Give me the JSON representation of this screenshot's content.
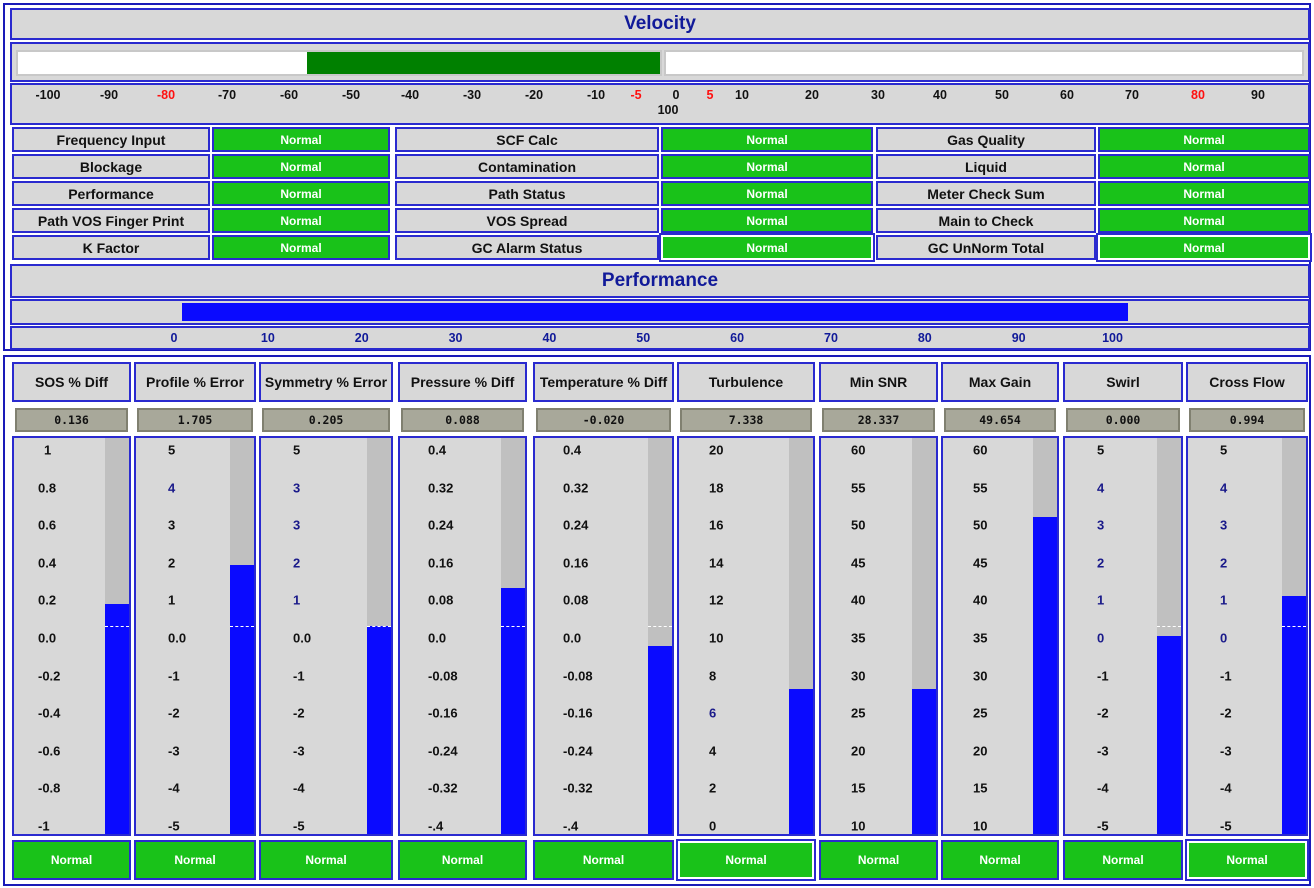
{
  "velocity": {
    "title": "Velocity",
    "value_range": [
      -55,
      0
    ],
    "scale": [
      {
        "label": "-100",
        "color": "black"
      },
      {
        "label": "-90",
        "color": "black"
      },
      {
        "label": "-80",
        "color": "red"
      },
      {
        "label": "-70",
        "color": "black"
      },
      {
        "label": "-60",
        "color": "black"
      },
      {
        "label": "-50",
        "color": "black"
      },
      {
        "label": "-40",
        "color": "black"
      },
      {
        "label": "-30",
        "color": "black"
      },
      {
        "label": "-20",
        "color": "black"
      },
      {
        "label": "-10",
        "color": "black"
      },
      {
        "label": "-5",
        "color": "red"
      },
      {
        "label": "0",
        "color": "black"
      },
      {
        "label": "5",
        "color": "red"
      },
      {
        "label": "10",
        "color": "black"
      },
      {
        "label": "20",
        "color": "black"
      },
      {
        "label": "30",
        "color": "black"
      },
      {
        "label": "40",
        "color": "black"
      },
      {
        "label": "50",
        "color": "black"
      },
      {
        "label": "60",
        "color": "black"
      },
      {
        "label": "70",
        "color": "black"
      },
      {
        "label": "80",
        "color": "red"
      },
      {
        "label": "90",
        "color": "black"
      },
      {
        "label": "100",
        "color": "black"
      }
    ]
  },
  "alarms": [
    {
      "label": "Frequency Input",
      "status": "Normal"
    },
    {
      "label": "SCF Calc",
      "status": "Normal"
    },
    {
      "label": "Gas Quality",
      "status": "Normal"
    },
    {
      "label": "Blockage",
      "status": "Normal"
    },
    {
      "label": "Contamination",
      "status": "Normal"
    },
    {
      "label": "Liquid",
      "status": "Normal"
    },
    {
      "label": "Performance",
      "status": "Normal"
    },
    {
      "label": "Path Status",
      "status": "Normal"
    },
    {
      "label": "Meter Check Sum",
      "status": "Normal"
    },
    {
      "label": "Path VOS Finger Print",
      "status": "Normal"
    },
    {
      "label": "VOS Spread",
      "status": "Normal"
    },
    {
      "label": "Main to Check",
      "status": "Normal"
    },
    {
      "label": "K Factor",
      "status": "Normal"
    },
    {
      "label": "GC Alarm Status",
      "status": "Normal"
    },
    {
      "label": "GC UnNorm Total",
      "status": "Normal"
    }
  ],
  "performance": {
    "title": "Performance",
    "value_percent": 100,
    "scale": [
      {
        "label": "0",
        "color": "blue"
      },
      {
        "label": "10",
        "color": "blue"
      },
      {
        "label": "20",
        "color": "blue"
      },
      {
        "label": "30",
        "color": "blue"
      },
      {
        "label": "40",
        "color": "blue"
      },
      {
        "label": "50",
        "color": "blue"
      },
      {
        "label": "60",
        "color": "blue"
      },
      {
        "label": "70",
        "color": "blue"
      },
      {
        "label": "80",
        "color": "blue"
      },
      {
        "label": "90",
        "color": "red"
      },
      {
        "label": "100",
        "color": "blue"
      }
    ]
  },
  "diagnostics": [
    {
      "title": "SOS % Diff",
      "value": "0.136",
      "status": "Normal",
      "fill_fraction": 0.58,
      "zero_fraction": 0.5,
      "scale": [
        {
          "t": "1",
          "c": 0
        },
        {
          "t": "0.8",
          "c": 0
        },
        {
          "t": "0.6",
          "c": 0
        },
        {
          "t": "0.4",
          "c": 0
        },
        {
          "t": "0.2",
          "c": 0
        },
        {
          "t": "0.0",
          "c": 0
        },
        {
          "t": "-0.2",
          "c": 0
        },
        {
          "t": "-0.4",
          "c": 0
        },
        {
          "t": "-0.6",
          "c": 0
        },
        {
          "t": "-0.8",
          "c": 0
        },
        {
          "t": "-1",
          "c": 0
        }
      ]
    },
    {
      "title": "Profile % Error",
      "value": "1.705",
      "status": "Normal",
      "fill_fraction": 0.68,
      "zero_fraction": 0.5,
      "scale": [
        {
          "t": "5",
          "c": 0
        },
        {
          "t": "4",
          "c": 1
        },
        {
          "t": "3",
          "c": 0
        },
        {
          "t": "2",
          "c": 0
        },
        {
          "t": "1",
          "c": 0
        },
        {
          "t": "0.0",
          "c": 0
        },
        {
          "t": "-1",
          "c": 0
        },
        {
          "t": "-2",
          "c": 0
        },
        {
          "t": "-3",
          "c": 0
        },
        {
          "t": "-4",
          "c": 0
        },
        {
          "t": "-5",
          "c": 0
        }
      ]
    },
    {
      "title": "Symmetry % Error",
      "value": "0.205",
      "status": "Normal",
      "fill_fraction": 0.525,
      "zero_fraction": 0.5,
      "scale": [
        {
          "t": "5",
          "c": 0
        },
        {
          "t": "3",
          "c": 1
        },
        {
          "t": "3",
          "c": 1
        },
        {
          "t": "2",
          "c": 1
        },
        {
          "t": "1",
          "c": 1
        },
        {
          "t": "0.0",
          "c": 0
        },
        {
          "t": "-1",
          "c": 0
        },
        {
          "t": "-2",
          "c": 0
        },
        {
          "t": "-3",
          "c": 0
        },
        {
          "t": "-4",
          "c": 0
        },
        {
          "t": "-5",
          "c": 0
        }
      ]
    },
    {
      "title": "Pressure % Diff",
      "value": "0.088",
      "status": "Normal",
      "fill_fraction": 0.62,
      "zero_fraction": 0.5,
      "scale": [
        {
          "t": "0.4",
          "c": 0
        },
        {
          "t": "0.32",
          "c": 0
        },
        {
          "t": "0.24",
          "c": 0
        },
        {
          "t": "0.16",
          "c": 0
        },
        {
          "t": "0.08",
          "c": 0
        },
        {
          "t": "0.0",
          "c": 0
        },
        {
          "t": "-0.08",
          "c": 0
        },
        {
          "t": "-0.16",
          "c": 0
        },
        {
          "t": "-0.24",
          "c": 0
        },
        {
          "t": "-0.32",
          "c": 0
        },
        {
          "t": "-.4",
          "c": 0
        }
      ]
    },
    {
      "title": "Temperature % Diff",
      "value": "-0.020",
      "status": "Normal",
      "fill_fraction": 0.475,
      "zero_fraction": 0.5,
      "scale": [
        {
          "t": "0.4",
          "c": 0
        },
        {
          "t": "0.32",
          "c": 0
        },
        {
          "t": "0.24",
          "c": 0
        },
        {
          "t": "0.16",
          "c": 0
        },
        {
          "t": "0.08",
          "c": 0
        },
        {
          "t": "0.0",
          "c": 0
        },
        {
          "t": "-0.08",
          "c": 0
        },
        {
          "t": "-0.16",
          "c": 0
        },
        {
          "t": "-0.24",
          "c": 0
        },
        {
          "t": "-0.32",
          "c": 0
        },
        {
          "t": "-.4",
          "c": 0
        }
      ]
    },
    {
      "title": "Turbulence",
      "value": "7.338",
      "status": "Normal",
      "fill_fraction": 0.367,
      "zero_fraction": null,
      "scale": [
        {
          "t": "20",
          "c": 0
        },
        {
          "t": "18",
          "c": 0
        },
        {
          "t": "16",
          "c": 0
        },
        {
          "t": "14",
          "c": 0
        },
        {
          "t": "12",
          "c": 0
        },
        {
          "t": "10",
          "c": 0
        },
        {
          "t": "8",
          "c": 0
        },
        {
          "t": "6",
          "c": 1
        },
        {
          "t": "4",
          "c": 0
        },
        {
          "t": "2",
          "c": 0
        },
        {
          "t": "0",
          "c": 0
        }
      ]
    },
    {
      "title": "Min SNR",
      "value": "28.337",
      "status": "Normal",
      "fill_fraction": 0.367,
      "zero_fraction": null,
      "scale": [
        {
          "t": "60",
          "c": 0
        },
        {
          "t": "55",
          "c": 0
        },
        {
          "t": "50",
          "c": 0
        },
        {
          "t": "45",
          "c": 0
        },
        {
          "t": "40",
          "c": 0
        },
        {
          "t": "35",
          "c": 0
        },
        {
          "t": "30",
          "c": 0
        },
        {
          "t": "25",
          "c": 0
        },
        {
          "t": "20",
          "c": 0
        },
        {
          "t": "15",
          "c": 0
        },
        {
          "t": "10",
          "c": 0
        }
      ]
    },
    {
      "title": "Max Gain",
      "value": "49.654",
      "status": "Normal",
      "fill_fraction": 0.8,
      "zero_fraction": null,
      "scale": [
        {
          "t": "60",
          "c": 0
        },
        {
          "t": "55",
          "c": 0
        },
        {
          "t": "50",
          "c": 0
        },
        {
          "t": "45",
          "c": 0
        },
        {
          "t": "40",
          "c": 0
        },
        {
          "t": "35",
          "c": 0
        },
        {
          "t": "30",
          "c": 0
        },
        {
          "t": "25",
          "c": 0
        },
        {
          "t": "20",
          "c": 0
        },
        {
          "t": "15",
          "c": 0
        },
        {
          "t": "10",
          "c": 0
        }
      ]
    },
    {
      "title": "Swirl",
      "value": "0.000",
      "status": "Normal",
      "fill_fraction": 0.5,
      "zero_fraction": 0.5,
      "scale": [
        {
          "t": "5",
          "c": 0
        },
        {
          "t": "4",
          "c": 1
        },
        {
          "t": "3",
          "c": 1
        },
        {
          "t": "2",
          "c": 1
        },
        {
          "t": "1",
          "c": 1
        },
        {
          "t": "0",
          "c": 1
        },
        {
          "t": "-1",
          "c": 0
        },
        {
          "t": "-2",
          "c": 0
        },
        {
          "t": "-3",
          "c": 0
        },
        {
          "t": "-4",
          "c": 0
        },
        {
          "t": "-5",
          "c": 0
        }
      ]
    },
    {
      "title": "Cross Flow",
      "value": "0.994",
      "status": "Normal",
      "fill_fraction": 0.6,
      "zero_fraction": 0.5,
      "scale": [
        {
          "t": "5",
          "c": 0
        },
        {
          "t": "4",
          "c": 1
        },
        {
          "t": "3",
          "c": 1
        },
        {
          "t": "2",
          "c": 1
        },
        {
          "t": "1",
          "c": 1
        },
        {
          "t": "0",
          "c": 1
        },
        {
          "t": "-1",
          "c": 0
        },
        {
          "t": "-2",
          "c": 0
        },
        {
          "t": "-3",
          "c": 0
        },
        {
          "t": "-4",
          "c": 0
        },
        {
          "t": "-5",
          "c": 0
        }
      ]
    }
  ],
  "colors": {
    "normal_green": "#19c219",
    "bar_blue": "#0a0aff",
    "velocity_green": "#008000",
    "border_blue": "#2a2acf",
    "title_blue": "#111a99",
    "alarm_red": "#ff1010"
  }
}
